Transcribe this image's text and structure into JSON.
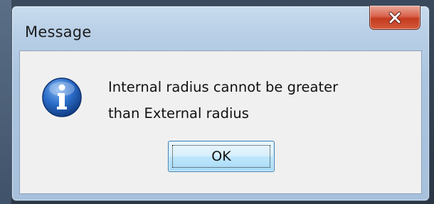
{
  "window": {
    "title": "Message"
  },
  "icons": {
    "close": "close-icon",
    "info": "info-icon"
  },
  "dialog": {
    "message": "Internal radius cannot be greater\nthan External radius",
    "ok_label": "OK"
  },
  "colors": {
    "close_button": "#c43b20",
    "info_icon": "#1f5fb8",
    "ok_button_border": "#3c7fb1"
  }
}
